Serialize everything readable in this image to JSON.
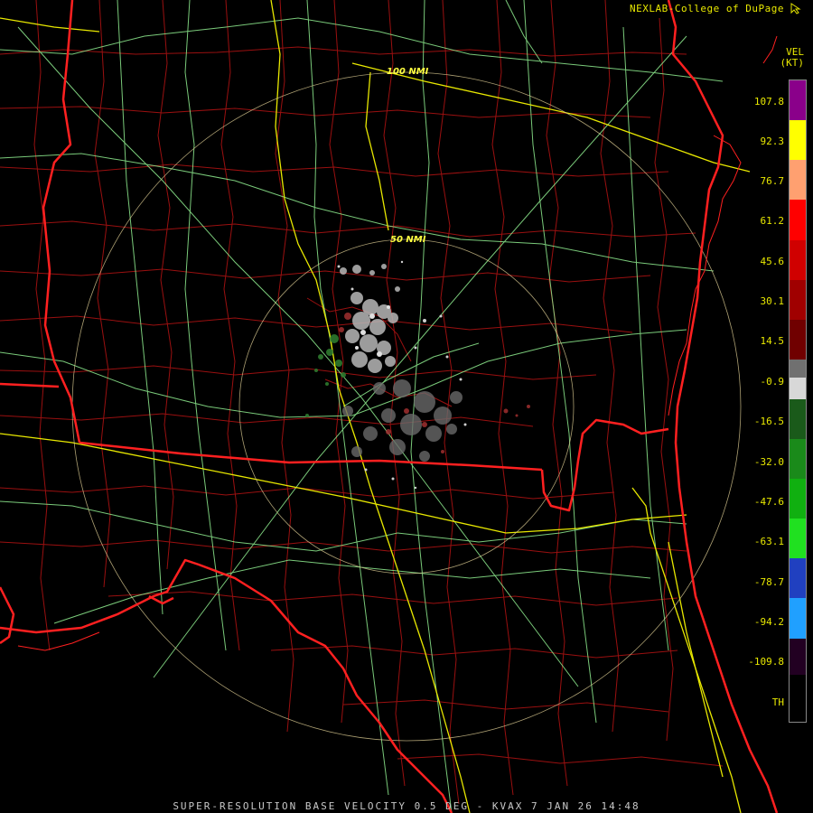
{
  "credit": "NEXLAB-College of DuPage",
  "legend": {
    "title": "VEL",
    "units": "(KT)",
    "ticks": [
      "107.8",
      "92.3",
      "76.7",
      "61.2",
      "45.6",
      "30.1",
      "14.5",
      "-0.9",
      "-16.5",
      "-32.0",
      "-47.6",
      "-63.1",
      "-78.7",
      "-94.2",
      "-109.8",
      "TH"
    ]
  },
  "rings": {
    "inner": "50 NMI",
    "outer": "100 NMI"
  },
  "footer": "SUPER-RESOLUTION BASE VELOCITY 0.5 DEG - KVAX 7 JAN 26 14:48",
  "colors": {
    "background": "#000000",
    "state_borders": "#ff2020",
    "county_lines": "#9a1010",
    "highways": "#e8e800",
    "roads": "#90ee90",
    "range_rings": "#d8c890",
    "text": "#e8e800"
  },
  "icons": {
    "corner": "cursor-icon"
  }
}
